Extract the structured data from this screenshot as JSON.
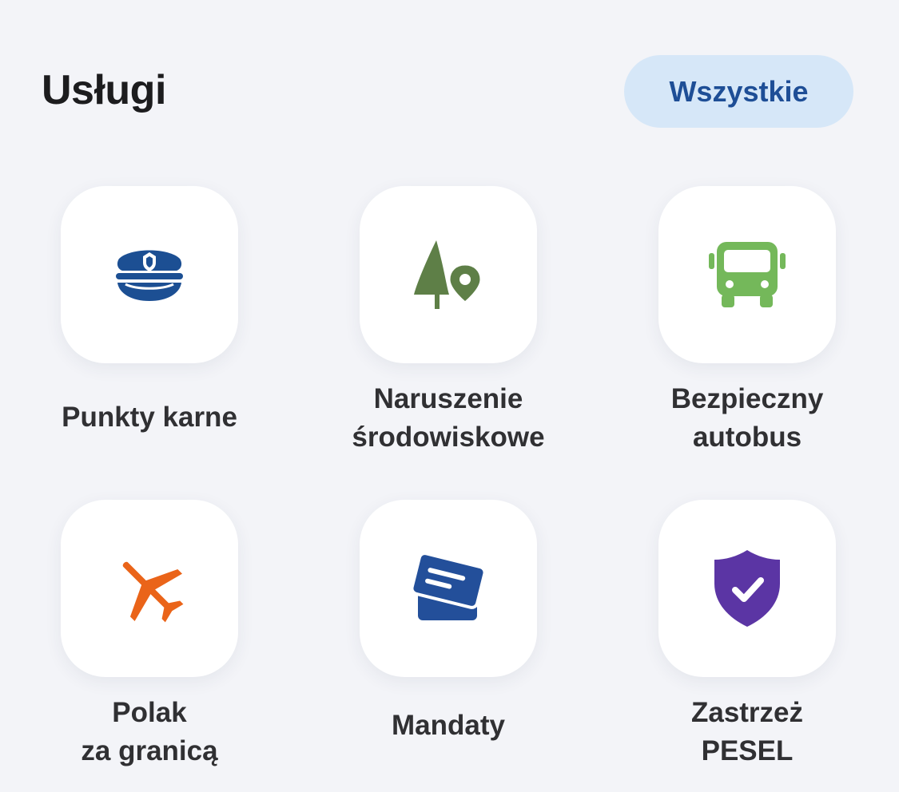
{
  "section": {
    "title": "Usługi",
    "all_button_label": "Wszystkie"
  },
  "tiles": [
    {
      "lines": [
        "Punkty karne"
      ],
      "icon": "police-cap-icon",
      "color": "#1c4f93"
    },
    {
      "lines": [
        "Naruszenie",
        "środowiskowe"
      ],
      "icon": "tree-location-icon",
      "color": "#5e7f47"
    },
    {
      "lines": [
        "Bezpieczny",
        "autobus"
      ],
      "icon": "bus-icon",
      "color": "#74b85a"
    },
    {
      "lines": [
        "Polak",
        "za granicą"
      ],
      "icon": "airplane-icon",
      "color": "#ea6419"
    },
    {
      "lines": [
        "Mandaty"
      ],
      "icon": "tickets-icon",
      "color": "#234f9a"
    },
    {
      "lines": [
        "Zastrzeż",
        "PESEL"
      ],
      "icon": "shield-check-icon",
      "color": "#5b35a4"
    }
  ]
}
